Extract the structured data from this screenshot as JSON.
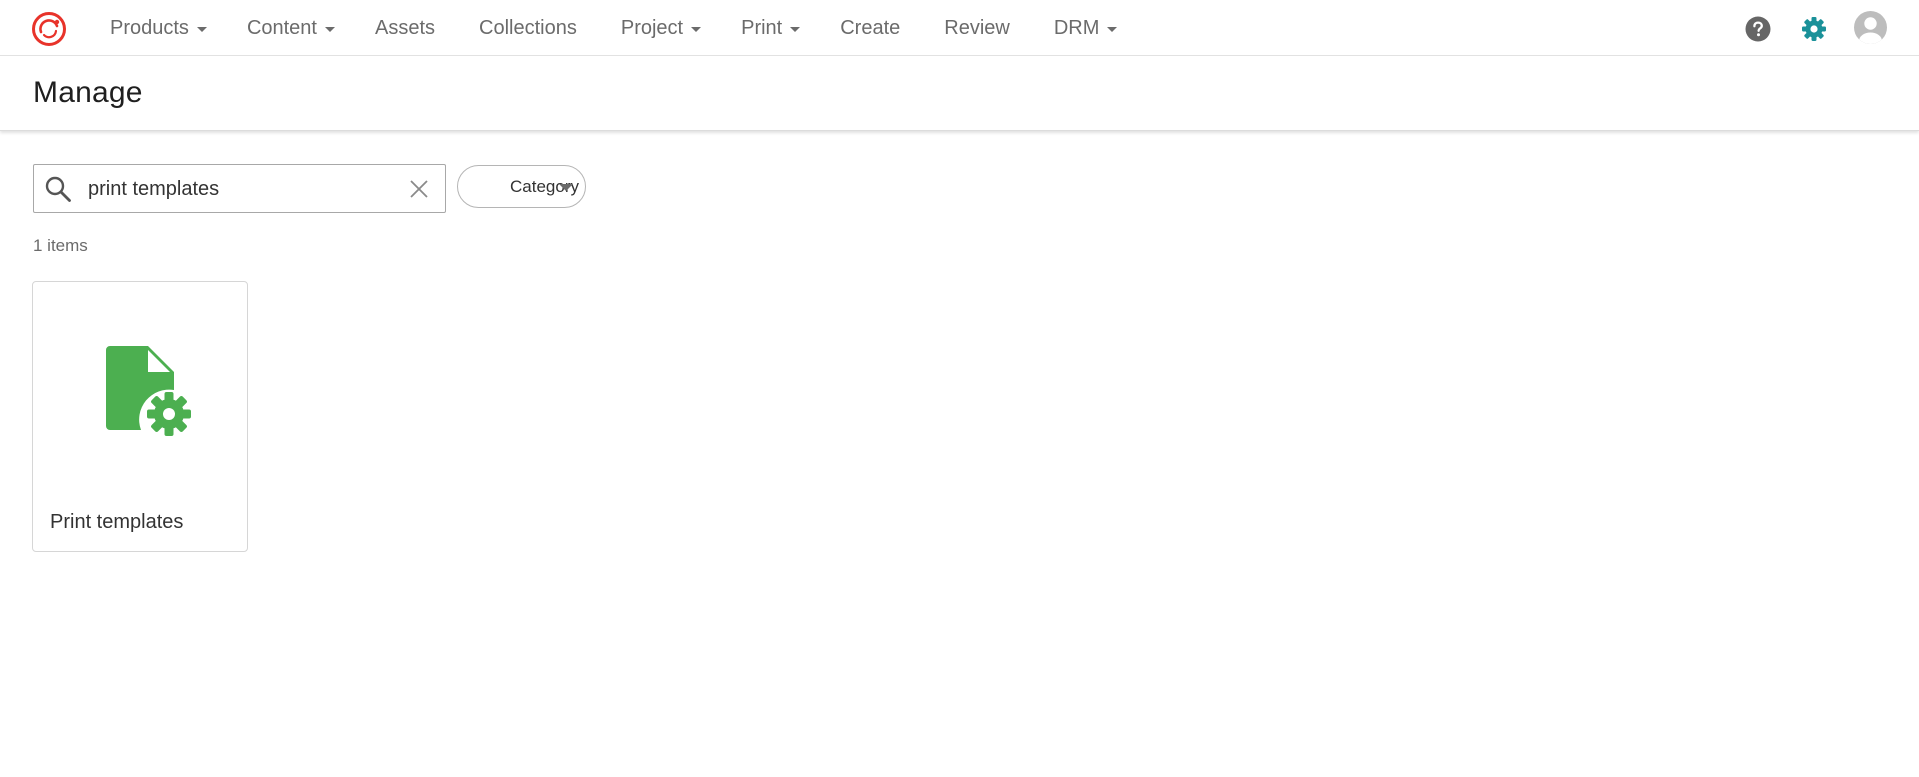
{
  "nav": {
    "logo_icon": "sitecore-logo-icon",
    "items": [
      {
        "label": "Products",
        "has_caret": true
      },
      {
        "label": "Content",
        "has_caret": true
      },
      {
        "label": "Assets",
        "has_caret": false
      },
      {
        "label": "Collections",
        "has_caret": false
      },
      {
        "label": "Project",
        "has_caret": true
      },
      {
        "label": "Print",
        "has_caret": true
      },
      {
        "label": "Create",
        "has_caret": false
      },
      {
        "label": "Review",
        "has_caret": false
      },
      {
        "label": "DRM",
        "has_caret": true
      }
    ],
    "right_icons": [
      "help-icon",
      "gear-icon",
      "avatar-icon"
    ],
    "gear_color": "#1a9199",
    "help_color": "#666666",
    "logo_color": "#e8332a"
  },
  "header": {
    "title": "Manage"
  },
  "toolbar": {
    "search": {
      "value": "print templates",
      "placeholder": ""
    },
    "category_label": "Category"
  },
  "results": {
    "count_text": "1 items",
    "tiles": [
      {
        "label": "Print templates",
        "icon": "file-gear-icon",
        "icon_color": "#4caf50"
      }
    ]
  }
}
